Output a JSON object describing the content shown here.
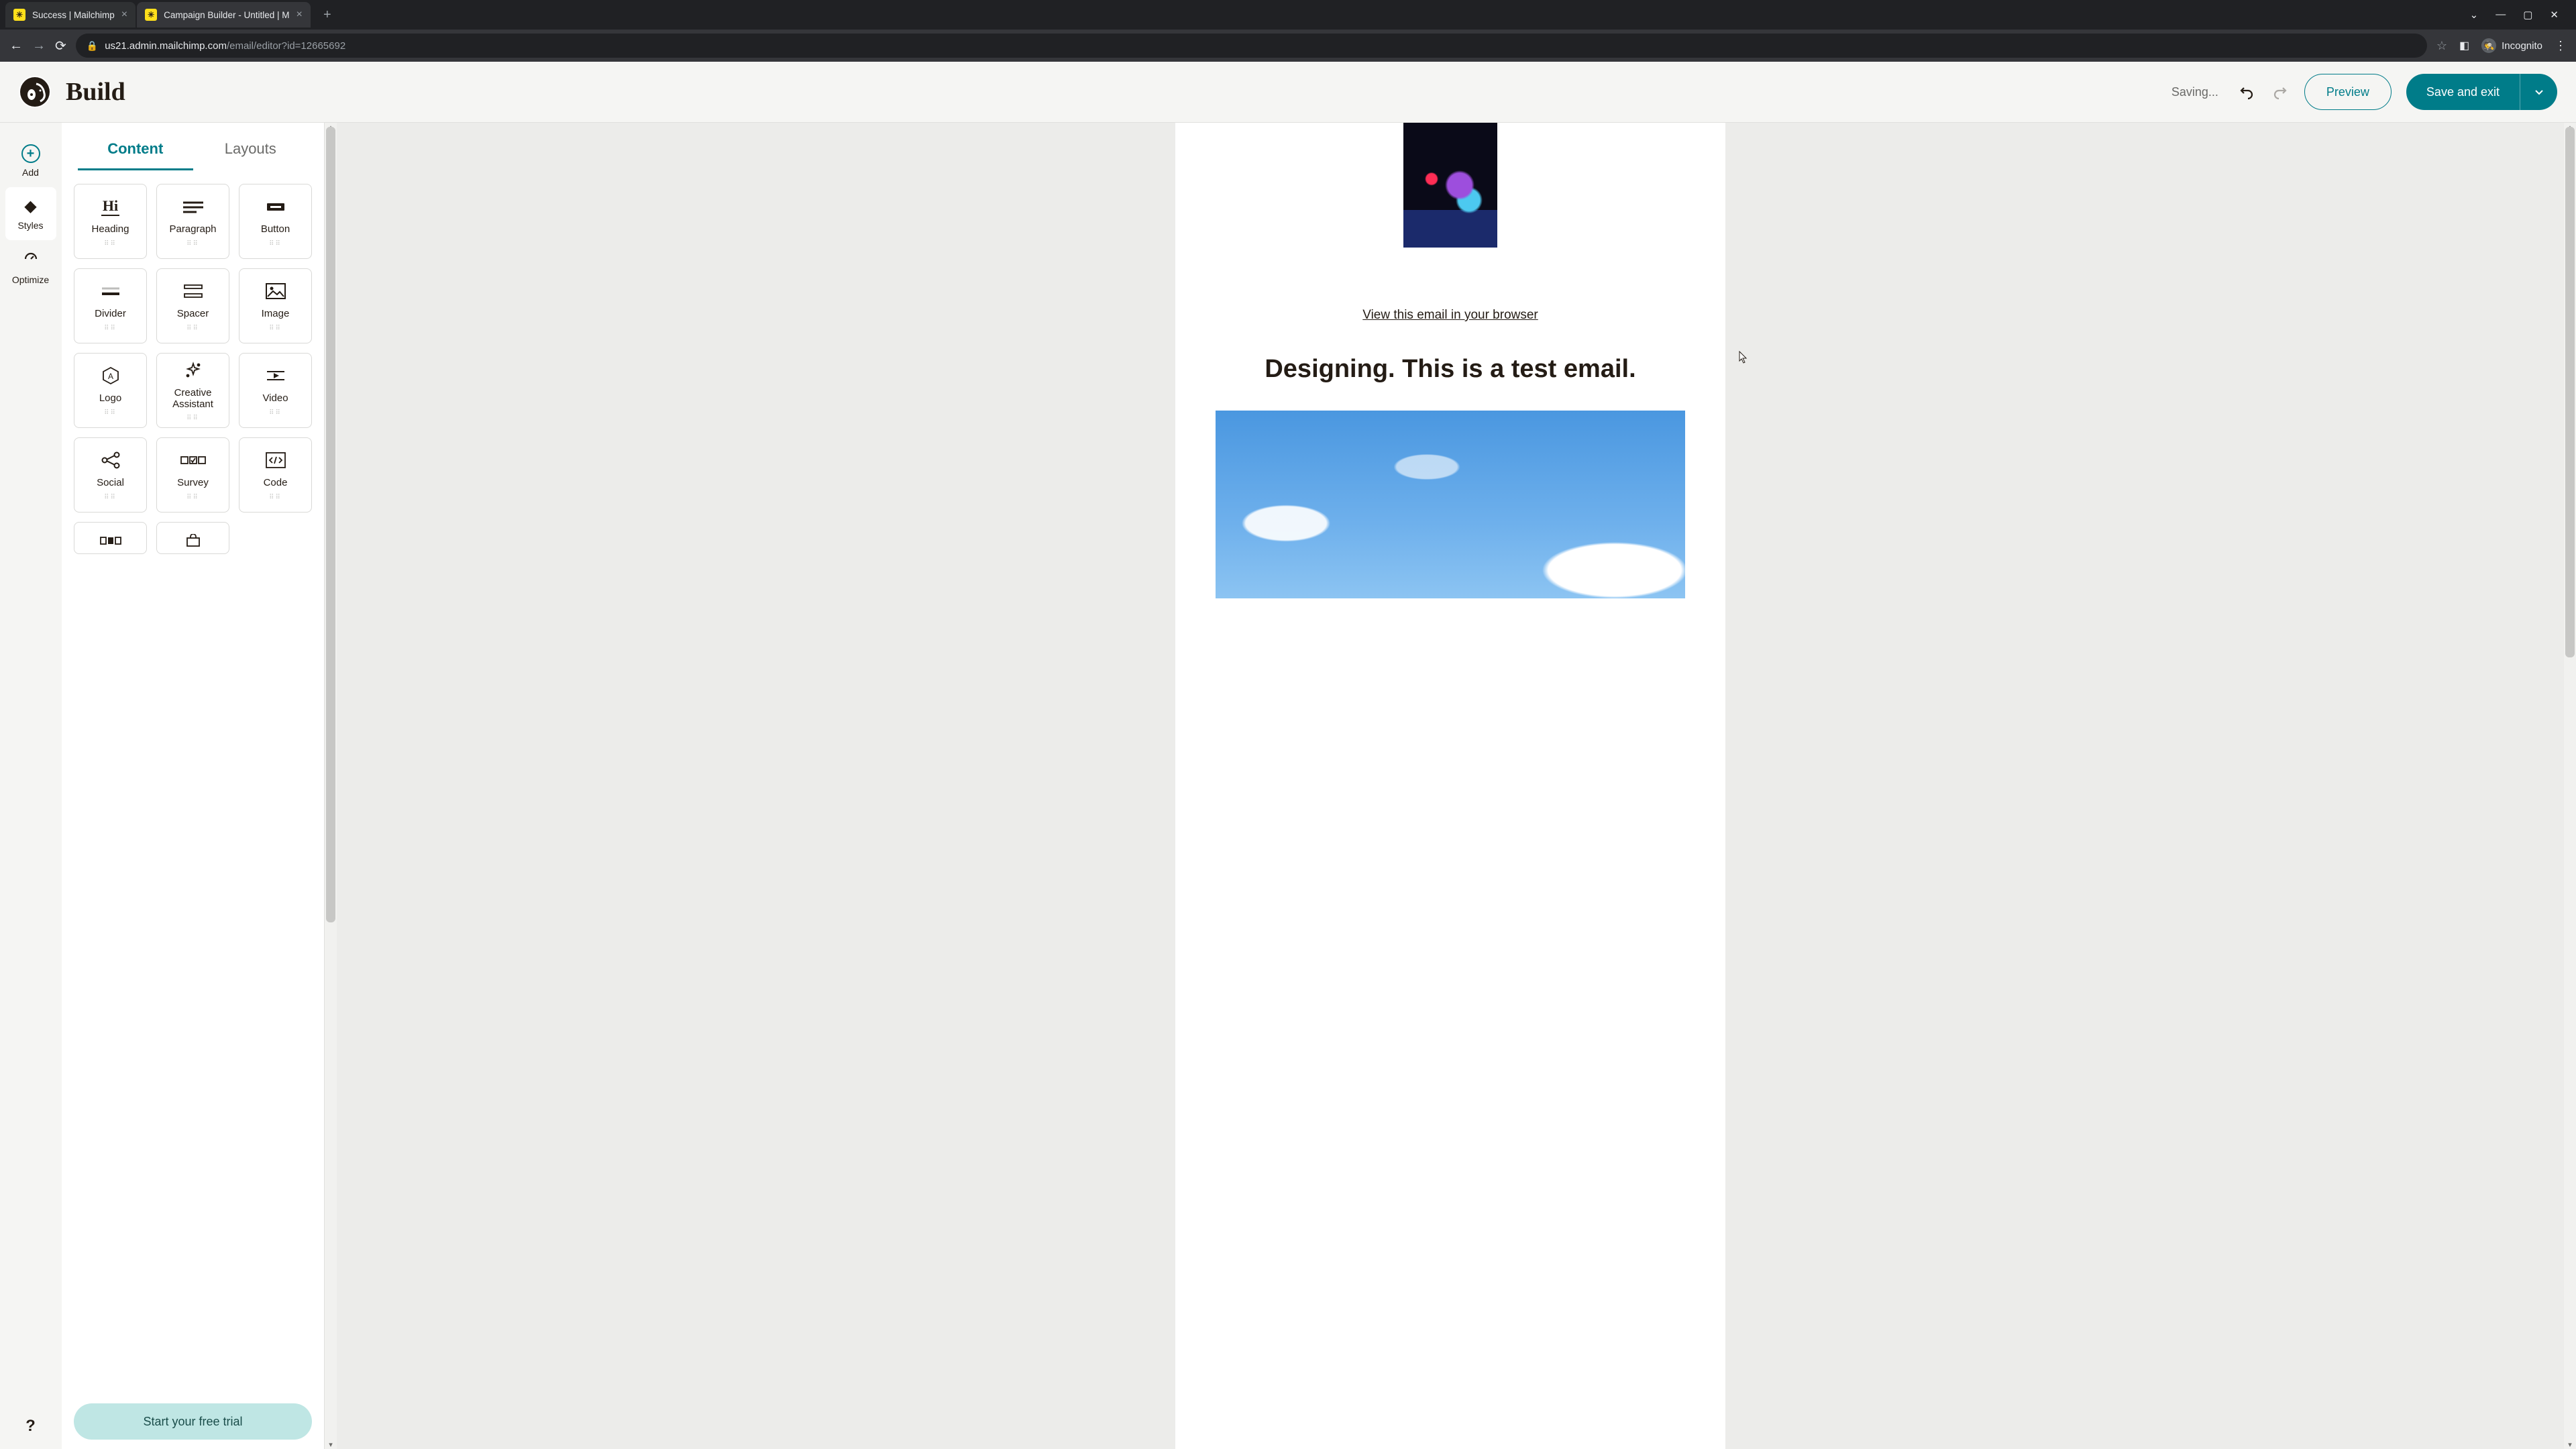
{
  "browser": {
    "tabs": [
      {
        "title": "Success | Mailchimp",
        "active": false
      },
      {
        "title": "Campaign Builder - Untitled | M",
        "active": true
      }
    ],
    "url_host": "us21.admin.mailchimp.com",
    "url_path": "/email/editor?id=12665692",
    "incognito_label": "Incognito"
  },
  "header": {
    "page_title": "Build",
    "status": "Saving...",
    "preview": "Preview",
    "save": "Save and exit"
  },
  "rail": {
    "add": "Add",
    "styles": "Styles",
    "optimize": "Optimize"
  },
  "sidebar": {
    "tab_content": "Content",
    "tab_layouts": "Layouts",
    "blocks": [
      {
        "id": "heading",
        "label": "Heading"
      },
      {
        "id": "paragraph",
        "label": "Paragraph"
      },
      {
        "id": "button",
        "label": "Button"
      },
      {
        "id": "divider",
        "label": "Divider"
      },
      {
        "id": "spacer",
        "label": "Spacer"
      },
      {
        "id": "image",
        "label": "Image"
      },
      {
        "id": "logo",
        "label": "Logo"
      },
      {
        "id": "creative",
        "label": "Creative\nAssistant"
      },
      {
        "id": "video",
        "label": "Video"
      },
      {
        "id": "social",
        "label": "Social"
      },
      {
        "id": "survey",
        "label": "Survey"
      },
      {
        "id": "code",
        "label": "Code"
      }
    ],
    "trial_cta": "Start your free trial"
  },
  "canvas": {
    "view_link": "View this email in your browser",
    "headline": "Designing. This is a test email."
  }
}
